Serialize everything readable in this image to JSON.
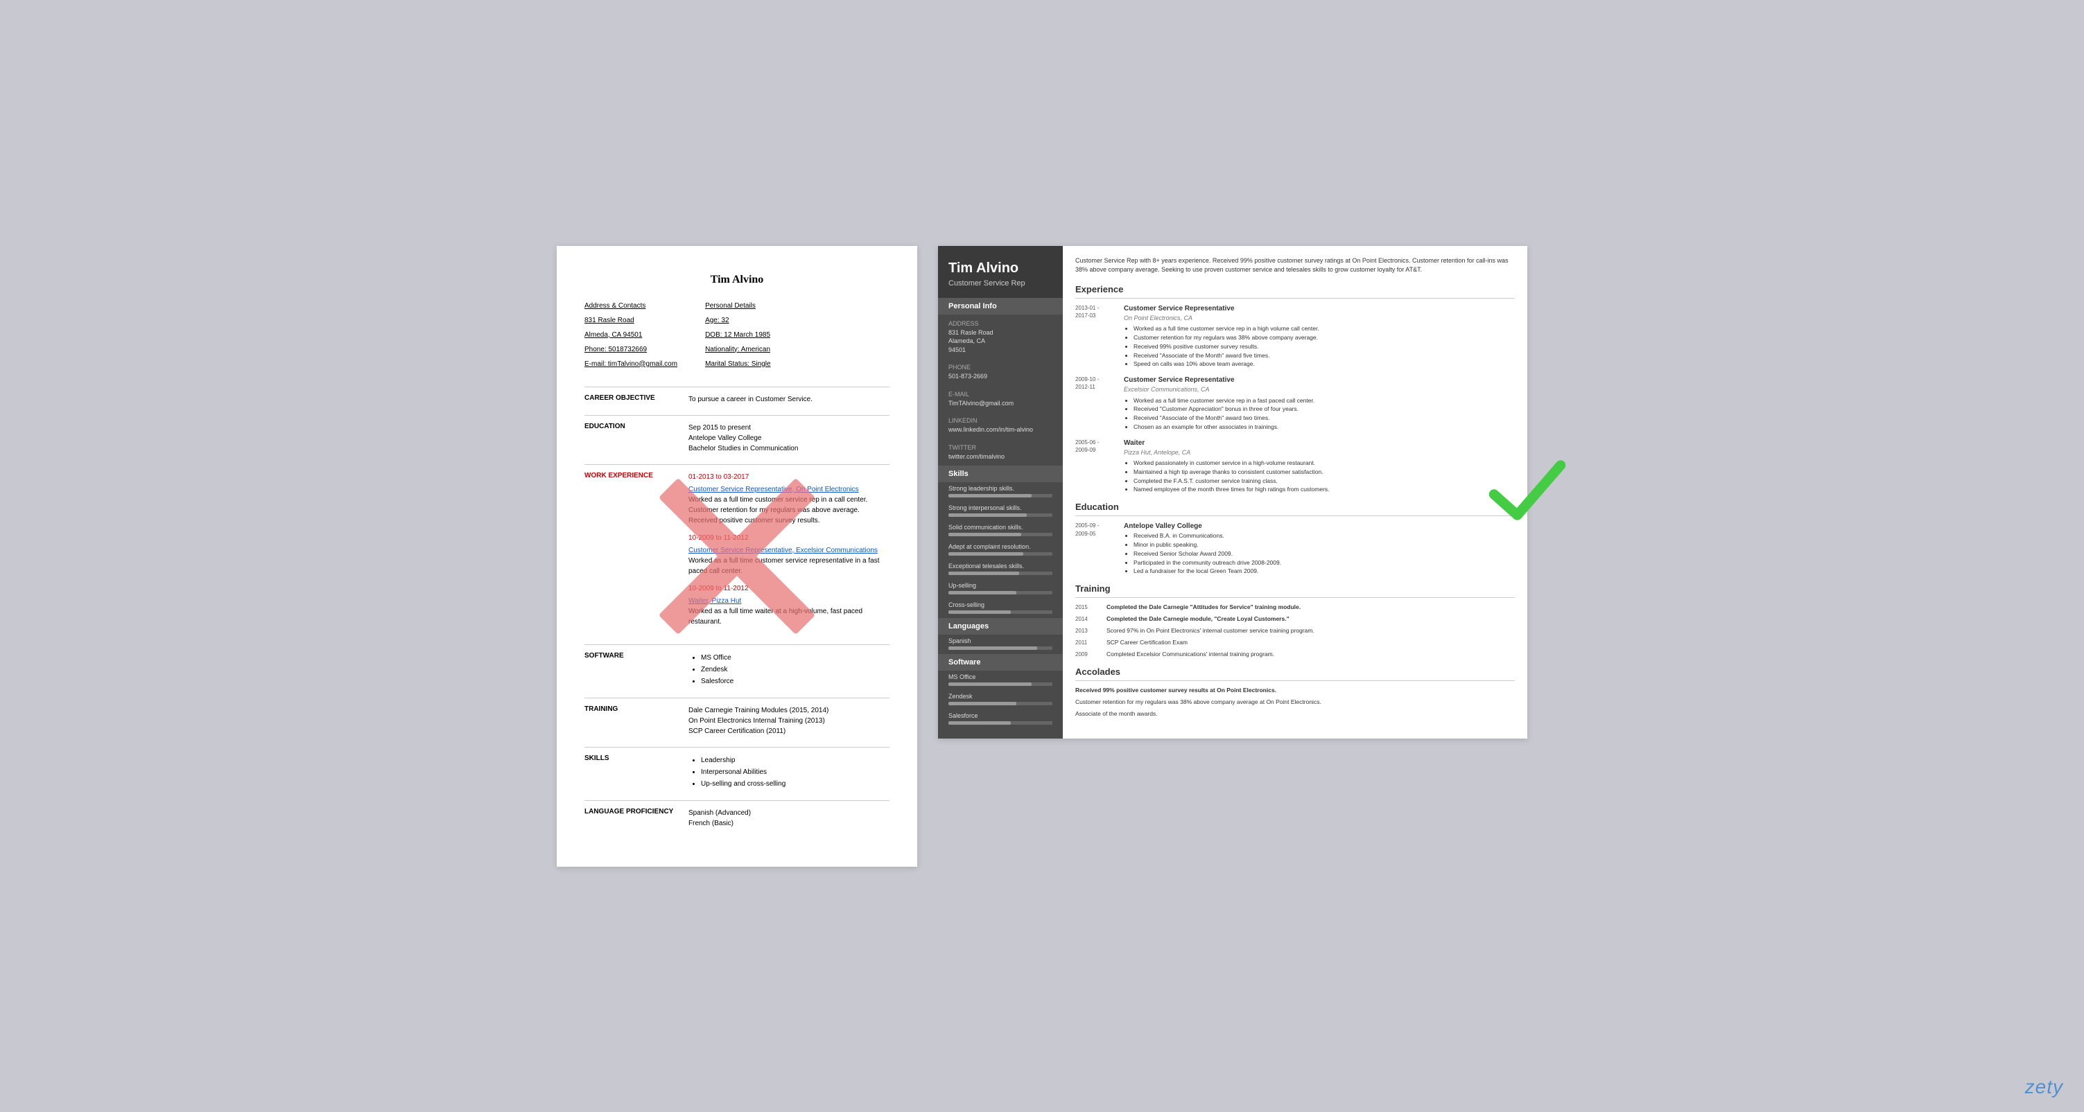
{
  "bad_resume": {
    "name": "Tim Alvino",
    "contact_header": "Address & Contacts",
    "address": "831 Rasle Road",
    "city_state": "Almeda, CA 94501",
    "phone": "Phone: 5018732669",
    "email": "E-mail: timTalvino@gmail.com",
    "personal_header": "Personal Details",
    "age": "Age:   32",
    "dob": "DOB:  12 March 1985",
    "nationality": "Nationality: American",
    "marital": "Marital Status: Single",
    "career_label": "CAREER OBJECTIVE",
    "career_text": "To pursue a career in Customer Service.",
    "education_label": "EDUCATION",
    "edu_dates": "Sep 2015 to present",
    "edu_school": "Antelope Valley College",
    "edu_degree": "Bachelor Studies in Communication",
    "work_label": "WORK EXPERIENCE",
    "work_dates_color": "red",
    "jobs": [
      {
        "dates": "01-2013 to 03-2017",
        "title": "Customer Service Representative, On Point Electronics",
        "desc": "Worked as a full time customer service rep in a call center. Customer retention for my regulars was above average. Received positive customer survey results."
      },
      {
        "dates": "10-2009 to 11-2012",
        "title": "Customer Service Representative, Excelsior Communications",
        "desc": "Worked as a full time customer service representative in a fast paced call center."
      },
      {
        "dates": "10-2009 to 11-2012",
        "title": "Waiter, Pizza Hut",
        "desc": "Worked as a full time waiter at a high-volume, fast paced restaurant."
      }
    ],
    "software_label": "SOFTWARE",
    "software_items": [
      "MS Office",
      "Zendesk",
      "Salesforce"
    ],
    "training_label": "TRAINING",
    "training_items": [
      "Dale Carnegie Training Modules (2015, 2014)",
      "On Point Electronics Internal Training (2013)",
      "SCP Career Certification (2011)"
    ],
    "skills_label": "SKILLS",
    "skills_items": [
      "Leadership",
      "Interpersonal Abilities",
      "Up-selling and cross-selling"
    ],
    "language_label": "LANGUAGE PROFICIENCY",
    "language_items": [
      "Spanish (Advanced)",
      "French (Basic)"
    ]
  },
  "good_resume": {
    "name": "Tim Alvino",
    "title": "Customer Service Rep",
    "summary": "Customer Service Rep with 8+ years experience. Received 99% positive customer survey ratings at On Point Electronics. Customer retention for call-ins was 38% above company average. Seeking to use proven customer service and telesales skills to grow customer loyalty for AT&T.",
    "sections": {
      "personal_info": "Personal Info",
      "skills": "Skills",
      "languages": "Languages",
      "software": "Software"
    },
    "personal_info": {
      "address_label": "Address",
      "address": "831 Rasle Road",
      "city": "Alameda, CA",
      "zip": "94501",
      "phone_label": "Phone",
      "phone": "501-873-2669",
      "email_label": "E-mail",
      "email": "TimTAlvino@gmail.com",
      "linkedin_label": "LinkedIn",
      "linkedin": "www.linkedin.com/in/tim-alvino",
      "twitter_label": "Twitter",
      "twitter": "twitter.com/timalvino"
    },
    "skills": [
      {
        "label": "Strong leadership skills.",
        "pct": 80
      },
      {
        "label": "Strong interpersonal skills.",
        "pct": 75
      },
      {
        "label": "Solid communication skills.",
        "pct": 70
      },
      {
        "label": "Adept at complaint resolution.",
        "pct": 72
      },
      {
        "label": "Exceptional telesales skills.",
        "pct": 68
      },
      {
        "label": "Up-selling",
        "pct": 65
      },
      {
        "label": "Cross-selling",
        "pct": 60
      }
    ],
    "languages": [
      {
        "name": "Spanish",
        "pct": 85
      }
    ],
    "software": [
      {
        "name": "MS Office",
        "pct": 80
      },
      {
        "name": "Zendesk",
        "pct": 65
      },
      {
        "name": "Salesforce",
        "pct": 60
      }
    ],
    "experience_title": "Experience",
    "experience": [
      {
        "dates": "2013-01 -\n2017-03",
        "job_title": "Customer Service Representative",
        "company": "On Point Electronics, CA",
        "bullets": [
          "Worked as a full time customer service rep in a high volume call center.",
          "Customer retention for my regulars was 38% above company average.",
          "Received 99% positive customer survey results.",
          "Received \"Associate of the Month\" award five times.",
          "Speed on calls was 10% above team average."
        ]
      },
      {
        "dates": "2009-10 -\n2012-11",
        "job_title": "Customer Service Representative",
        "company": "Excelsior Communications, CA",
        "bullets": [
          "Worked as a full time customer service rep in a fast paced call center.",
          "Received \"Customer Appreciation\" bonus in three of four years.",
          "Received \"Associate of the Month\" award two times.",
          "Chosen as an example for other associates in trainings."
        ]
      },
      {
        "dates": "2005-06 -\n2009-09",
        "job_title": "Waiter",
        "company": "Pizza Hut, Antelope, CA",
        "bullets": [
          "Worked passionately in customer service in a high-volume restaurant.",
          "Maintained a high tip average thanks to consistent customer satisfaction.",
          "Completed the F.A.S.T. customer service training class.",
          "Named employee of the month three times for high ratings from customers."
        ]
      }
    ],
    "education_title": "Education",
    "education": [
      {
        "dates": "2005-09 -\n2009-05",
        "school": "Antelope Valley College",
        "bullets": [
          "Received B.A. in Communications.",
          "Minor in public speaking.",
          "Received Senior Scholar Award 2009.",
          "Participated in the community outreach drive 2008-2009.",
          "Led a fundraiser for the local Green Team 2009."
        ]
      }
    ],
    "training_title": "Training",
    "training": [
      {
        "year": "2015",
        "desc": "Completed the Dale Carnegie \"Attitudes for Service\" training module.",
        "bold": true
      },
      {
        "year": "2014",
        "desc": "Completed the Dale Carnegie module, \"Create Loyal Customers.\"",
        "bold": true
      },
      {
        "year": "2013",
        "desc": "Scored 97% in On Point Electronics' internal customer service training program.",
        "bold": false
      },
      {
        "year": "2011",
        "desc": "SCP Career Certification Exam",
        "bold": false
      },
      {
        "year": "2009",
        "desc": "Completed Excelsior Communications' internal training program.",
        "bold": false
      }
    ],
    "accolades_title": "Accolades",
    "accolades": [
      {
        "text": "Received 99% positive customer survey results at On Point Electronics.",
        "bold": true
      },
      {
        "text": "Customer retention for my regulars was 38% above company average at On Point Electronics.",
        "bold": false
      },
      {
        "text": "Associate of the month awards.",
        "bold": false
      }
    ]
  },
  "watermark": "zety"
}
